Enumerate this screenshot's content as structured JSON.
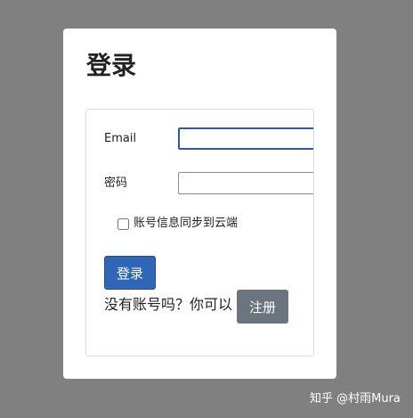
{
  "page": {
    "title": "登录"
  },
  "form": {
    "email_label": "Email",
    "email_value": "",
    "password_label": "密码",
    "password_value": "",
    "sync_checkbox_label": "账号信息同步到云端",
    "sync_checked": false,
    "login_button": "登录",
    "register_prompt": "没有账号吗？你可以",
    "register_button": "注册"
  },
  "watermark": {
    "text": "知乎 @村雨Mura"
  },
  "colors": {
    "background": "#808080",
    "primary": "#2f67b6",
    "secondary": "#6c757d",
    "focus_border": "#2c5aa0"
  }
}
